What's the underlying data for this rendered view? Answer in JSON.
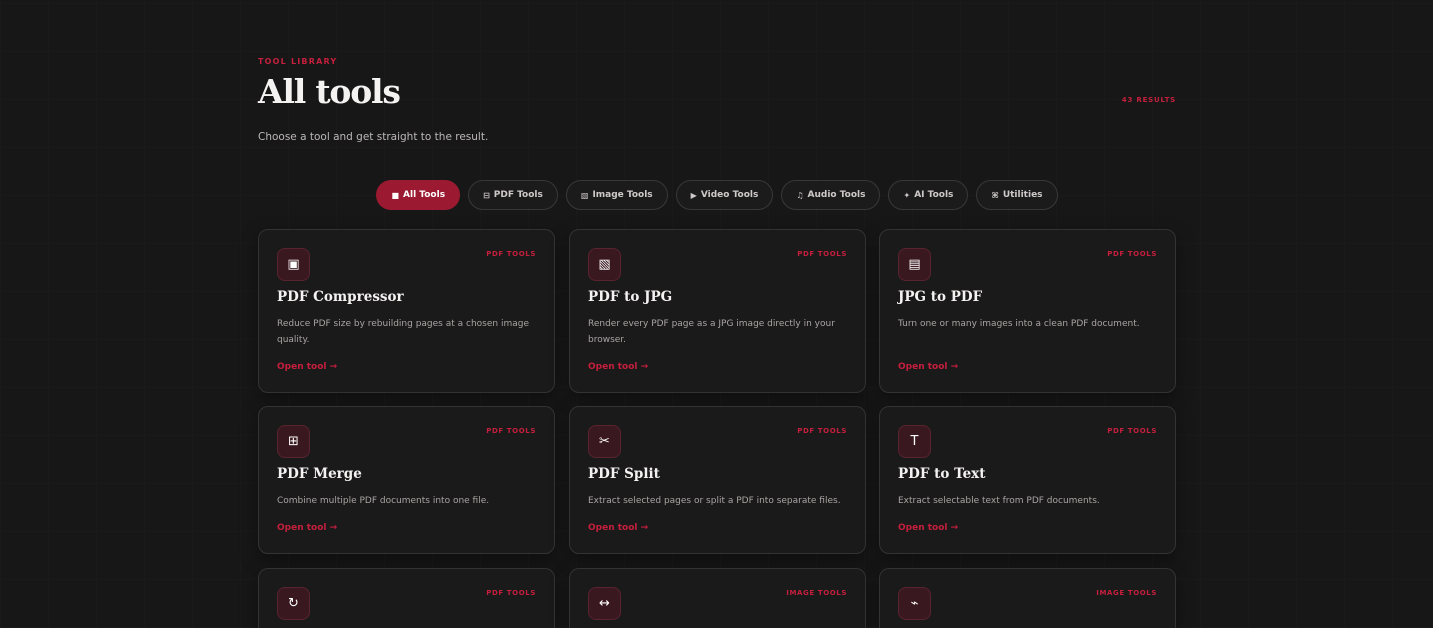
{
  "header": {
    "eyebrow": "TOOL LIBRARY",
    "title": "All tools",
    "results": "43 RESULTS",
    "subtitle": "Choose a tool and get straight to the result."
  },
  "filters": [
    {
      "icon": "■",
      "label": "All Tools",
      "active": true
    },
    {
      "icon": "⊟",
      "label": "PDF Tools",
      "active": false
    },
    {
      "icon": "▧",
      "label": "Image Tools",
      "active": false
    },
    {
      "icon": "▶",
      "label": "Video Tools",
      "active": false
    },
    {
      "icon": "♫",
      "label": "Audio Tools",
      "active": false
    },
    {
      "icon": "✦",
      "label": "AI Tools",
      "active": false
    },
    {
      "icon": "⌘",
      "label": "Utilities",
      "active": false
    }
  ],
  "cards": [
    {
      "icon": "▣",
      "icon_name": "compress-icon",
      "category": "PDF TOOLS",
      "name": "PDF Compressor",
      "desc": "Reduce PDF size by rebuilding pages at a chosen image quality.",
      "link": "Open tool →"
    },
    {
      "icon": "▧",
      "icon_name": "image-icon",
      "category": "PDF TOOLS",
      "name": "PDF to JPG",
      "desc": "Render every PDF page as a JPG image directly in your browser.",
      "link": "Open tool →"
    },
    {
      "icon": "▤",
      "icon_name": "document-icon",
      "category": "PDF TOOLS",
      "name": "JPG to PDF",
      "desc": "Turn one or many images into a clean PDF document.",
      "link": "Open tool →"
    },
    {
      "icon": "⊞",
      "icon_name": "merge-icon",
      "category": "PDF TOOLS",
      "name": "PDF Merge",
      "desc": "Combine multiple PDF documents into one file.",
      "link": "Open tool →"
    },
    {
      "icon": "✂",
      "icon_name": "scissors-icon",
      "category": "PDF TOOLS",
      "name": "PDF Split",
      "desc": "Extract selected pages or split a PDF into separate files.",
      "link": "Open tool →"
    },
    {
      "icon": "T",
      "icon_name": "text-icon",
      "category": "PDF TOOLS",
      "name": "PDF to Text",
      "desc": "Extract selectable text from PDF documents.",
      "link": "Open tool →"
    },
    {
      "icon": "↻",
      "icon_name": "rotate-icon",
      "category": "PDF TOOLS",
      "name": "",
      "desc": "",
      "link": ""
    },
    {
      "icon": "↔",
      "icon_name": "resize-icon",
      "category": "IMAGE TOOLS",
      "name": "",
      "desc": "",
      "link": ""
    },
    {
      "icon": "⌁",
      "icon_name": "crop-icon",
      "category": "IMAGE TOOLS",
      "name": "",
      "desc": "",
      "link": ""
    }
  ],
  "colors": {
    "accent": "#c51f3d",
    "accent_dark": "#9c1a31",
    "background": "#171717",
    "card": "#1b1a1a"
  }
}
